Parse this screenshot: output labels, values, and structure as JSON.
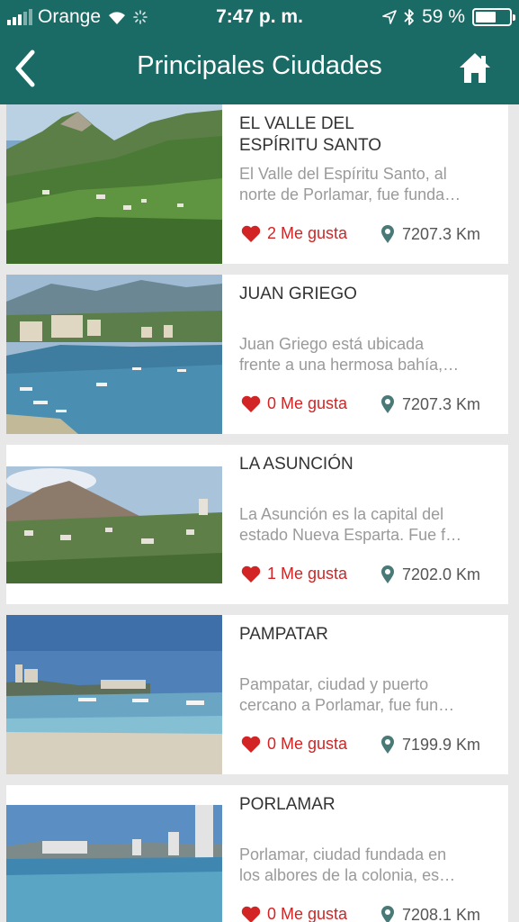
{
  "status_bar": {
    "carrier": "Orange",
    "time": "7:47 p. m.",
    "battery": "59 %"
  },
  "header": {
    "title": "Principales Ciudades"
  },
  "cities": [
    {
      "name_line1": "EL VALLE DEL",
      "name_line2": "ESPÍRITU SANTO",
      "desc_line1": "El Valle del Espíritu Santo, al",
      "desc_line2": "norte de Porlamar, fue funda…",
      "likes": "2 Me gusta",
      "distance": "7207.3 Km"
    },
    {
      "name_line1": "JUAN GRIEGO",
      "name_line2": "",
      "desc_line1": "Juan Griego está ubicada",
      "desc_line2": "frente a una hermosa bahía,…",
      "likes": "0 Me gusta",
      "distance": "7207.3 Km"
    },
    {
      "name_line1": "LA ASUNCIÓN",
      "name_line2": "",
      "desc_line1": "La Asunción es la capital del",
      "desc_line2": "estado Nueva Esparta. Fue f…",
      "likes": "1 Me gusta",
      "distance": "7202.0 Km"
    },
    {
      "name_line1": "PAMPATAR",
      "name_line2": "",
      "desc_line1": "Pampatar, ciudad y puerto",
      "desc_line2": "cercano a Porlamar,  fue fun…",
      "likes": "0 Me gusta",
      "distance": "7199.9 Km"
    },
    {
      "name_line1": "PORLAMAR",
      "name_line2": "",
      "desc_line1": "Porlamar, ciudad fundada en",
      "desc_line2": "los albores de la colonia, es…",
      "likes": "0 Me gusta",
      "distance": "7208.1 Km"
    }
  ],
  "icons": {
    "back": "chevron-left-icon",
    "home": "home-icon",
    "like": "heart-icon",
    "location": "map-pin-icon"
  },
  "colors": {
    "header": "#1a6a66",
    "like": "#d22424",
    "pin": "#4a7a78"
  }
}
